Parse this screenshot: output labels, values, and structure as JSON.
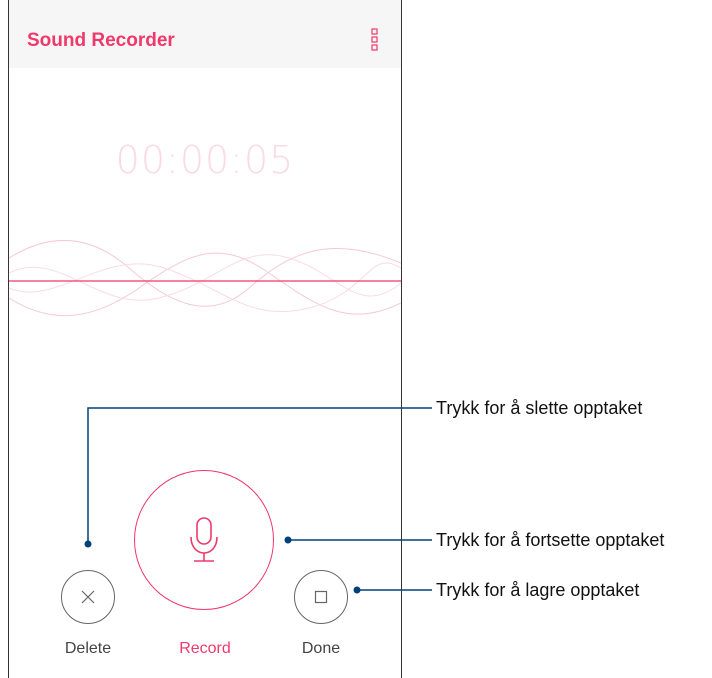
{
  "app": {
    "title": "Sound Recorder"
  },
  "recorder": {
    "elapsed_time": "00:00:05"
  },
  "controls": {
    "delete_label": "Delete",
    "record_label": "Record",
    "done_label": "Done"
  },
  "callouts": {
    "delete": "Trykk for å slette opptaket",
    "record": "Trykk for å fortsette opptaket",
    "done": "Trykk for å lagre opptaket"
  },
  "icons": {
    "menu": "more-vertical-icon",
    "delete": "close-icon",
    "record": "microphone-icon",
    "done": "stop-square-icon"
  },
  "colors": {
    "accent": "#f0386b",
    "timer": "#fbdbe3",
    "appbar_bg": "#f6f6f6",
    "callout_line": "#00407a"
  }
}
